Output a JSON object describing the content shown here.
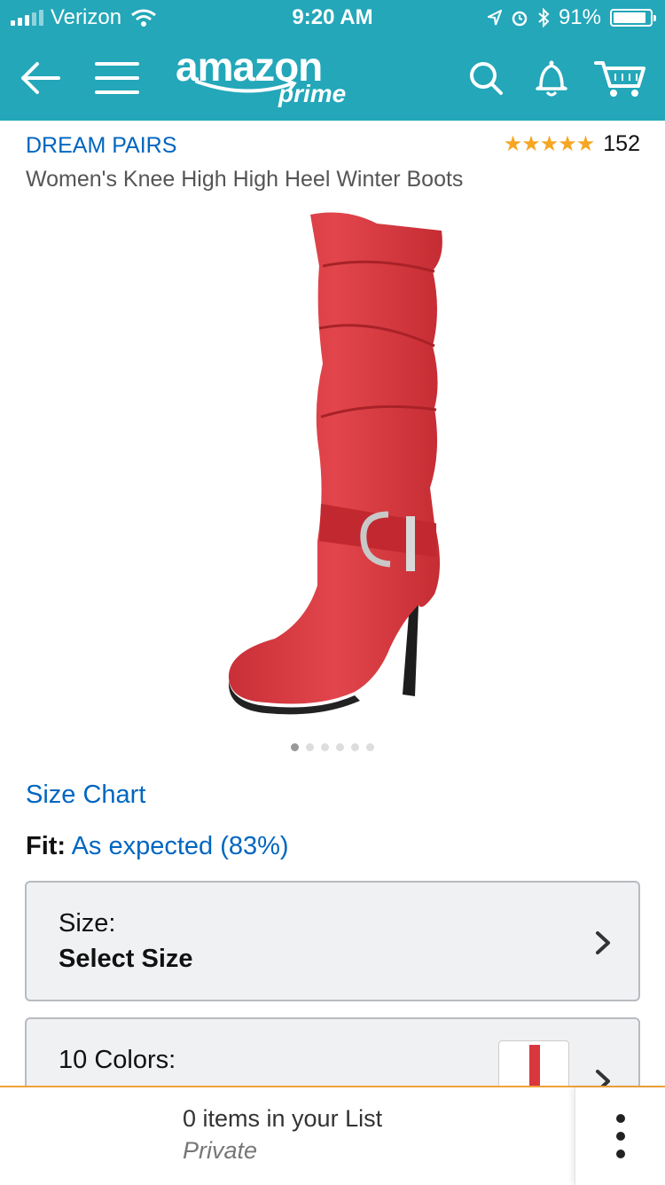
{
  "status_bar": {
    "carrier": "Verizon",
    "time": "9:20 AM",
    "battery_percent": "91%",
    "battery_level": 0.91
  },
  "nav": {
    "logo_text": "amazon",
    "logo_sub": "prime",
    "icons": [
      "back-arrow-icon",
      "menu-icon",
      "search-icon",
      "bell-icon",
      "cart-icon"
    ]
  },
  "product": {
    "brand": "DREAM PAIRS",
    "title": "Women's Knee High High Heel Winter Boots",
    "rating_stars": "★★★★★",
    "rating_value": 4.5,
    "rating_count": "152",
    "image_count": 6,
    "active_image": 1
  },
  "links": {
    "size_chart": "Size Chart",
    "fit_label": "Fit:",
    "fit_value": "As expected (83%)"
  },
  "size_selector": {
    "label": "Size:",
    "value": "Select Size"
  },
  "color_selector": {
    "label": "10 Colors:"
  },
  "bottom_bar": {
    "list_text": "0 items in your List",
    "list_sub": "Private"
  },
  "colors": {
    "nav_bg": "#23a7b9",
    "link": "#0066c0",
    "star": "#f5a623",
    "boot_red": "#d9363e",
    "bottom_border": "#f0a23a"
  }
}
